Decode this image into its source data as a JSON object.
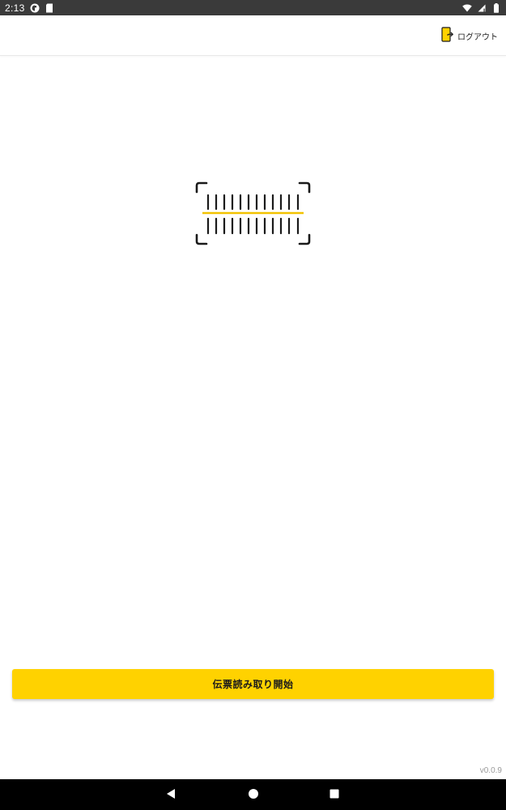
{
  "status_bar": {
    "time": "2:13",
    "left_icons": [
      "assistant-icon",
      "sd-card-icon"
    ],
    "right_icons": [
      "wifi-icon",
      "signal-icon",
      "battery-icon"
    ]
  },
  "app_bar": {
    "logout_label": "ログアウト",
    "logout_icon": "logout-door-icon"
  },
  "main": {
    "illustration": "barcode-scan-icon",
    "start_button_label": "伝票読み取り開始"
  },
  "footer": {
    "version": "v0.0.9"
  },
  "nav_bar": {
    "buttons": [
      "back-icon",
      "home-icon",
      "recents-icon"
    ]
  },
  "colors": {
    "accent": "#FFD200",
    "status_bar": "#3a3a3a",
    "nav_bar": "#000000",
    "scan_line": "#F2C200"
  }
}
